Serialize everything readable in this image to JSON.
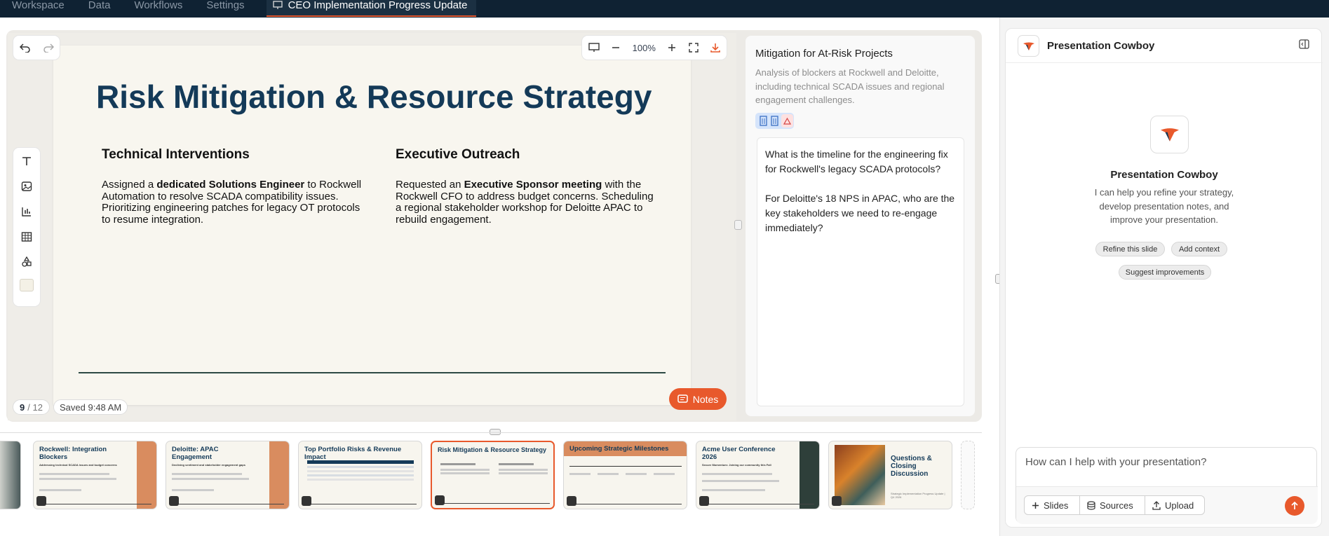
{
  "nav": {
    "tabs": [
      "Workspace",
      "Data",
      "Workflows",
      "Settings"
    ],
    "active_tab": "CEO Implementation Progress Update"
  },
  "editor": {
    "zoom": "100%",
    "page_current": "9",
    "page_total": "/ 12",
    "saved": "Saved 9:48 AM",
    "notes_label": "Notes"
  },
  "slide": {
    "title": "Risk Mitigation & Resource Strategy",
    "left": {
      "heading": "Technical Interventions",
      "pre": "Assigned a ",
      "bold": "dedicated Solutions Engineer",
      "post": " to Rockwell Automation to resolve SCADA compatibility issues. Prioritizing engineering patches for legacy OT protocols to resume integration."
    },
    "right": {
      "heading": "Executive Outreach",
      "pre": "Requested an ",
      "bold": "Executive Sponsor meeting",
      "post": " with the Rockwell CFO to address budget concerns. Scheduling a regional stakeholder workshop for Deloitte APAC to rebuild engagement."
    }
  },
  "notes_panel": {
    "title": "Mitigation for At-Risk Projects",
    "description": "Analysis of blockers at Rockwell and Deloitte, including technical SCADA issues and regional engagement challenges.",
    "text": "What is the timeline for the engineering fix for Rockwell's legacy SCADA protocols?\n\nFor Deloitte's 18 NPS in APAC, who are the key stakeholders we need to re-engage immediately?"
  },
  "thumbnails": [
    {
      "title": "Rockwell: Integration Blockers",
      "subtitle": "Addressing technical SCADA issues and budget concerns"
    },
    {
      "title": "Deloitte: APAC Engagement",
      "subtitle": "Declining sentiment and stakeholder engagement gaps"
    },
    {
      "title": "Top Portfolio Risks & Revenue Impact",
      "subtitle": ""
    },
    {
      "title": "Risk Mitigation & Resource Strategy",
      "subtitle": ""
    },
    {
      "title": "Upcoming Strategic Milestones",
      "subtitle": ""
    },
    {
      "title": "Acme User Conference 2026",
      "subtitle": "Secure Momentum: Joining our community this Fall"
    },
    {
      "title": "Questions & Closing Discussion",
      "subtitle": "Strategic Implementation Progress Update | Q4 2026"
    }
  ],
  "chat": {
    "assistant_name": "Presentation Cowboy",
    "intro": "I can help you refine your strategy, develop presentation notes, and improve your presentation.",
    "chips": [
      "Refine this slide",
      "Add context",
      "Suggest improvements"
    ],
    "input_placeholder": "How can I help with your presentation?",
    "buttons": [
      "Slides",
      "Sources",
      "Upload"
    ]
  },
  "colors": {
    "accent": "#e8592c",
    "slide_title": "#143a58",
    "nav_bg": "#0f2233"
  }
}
